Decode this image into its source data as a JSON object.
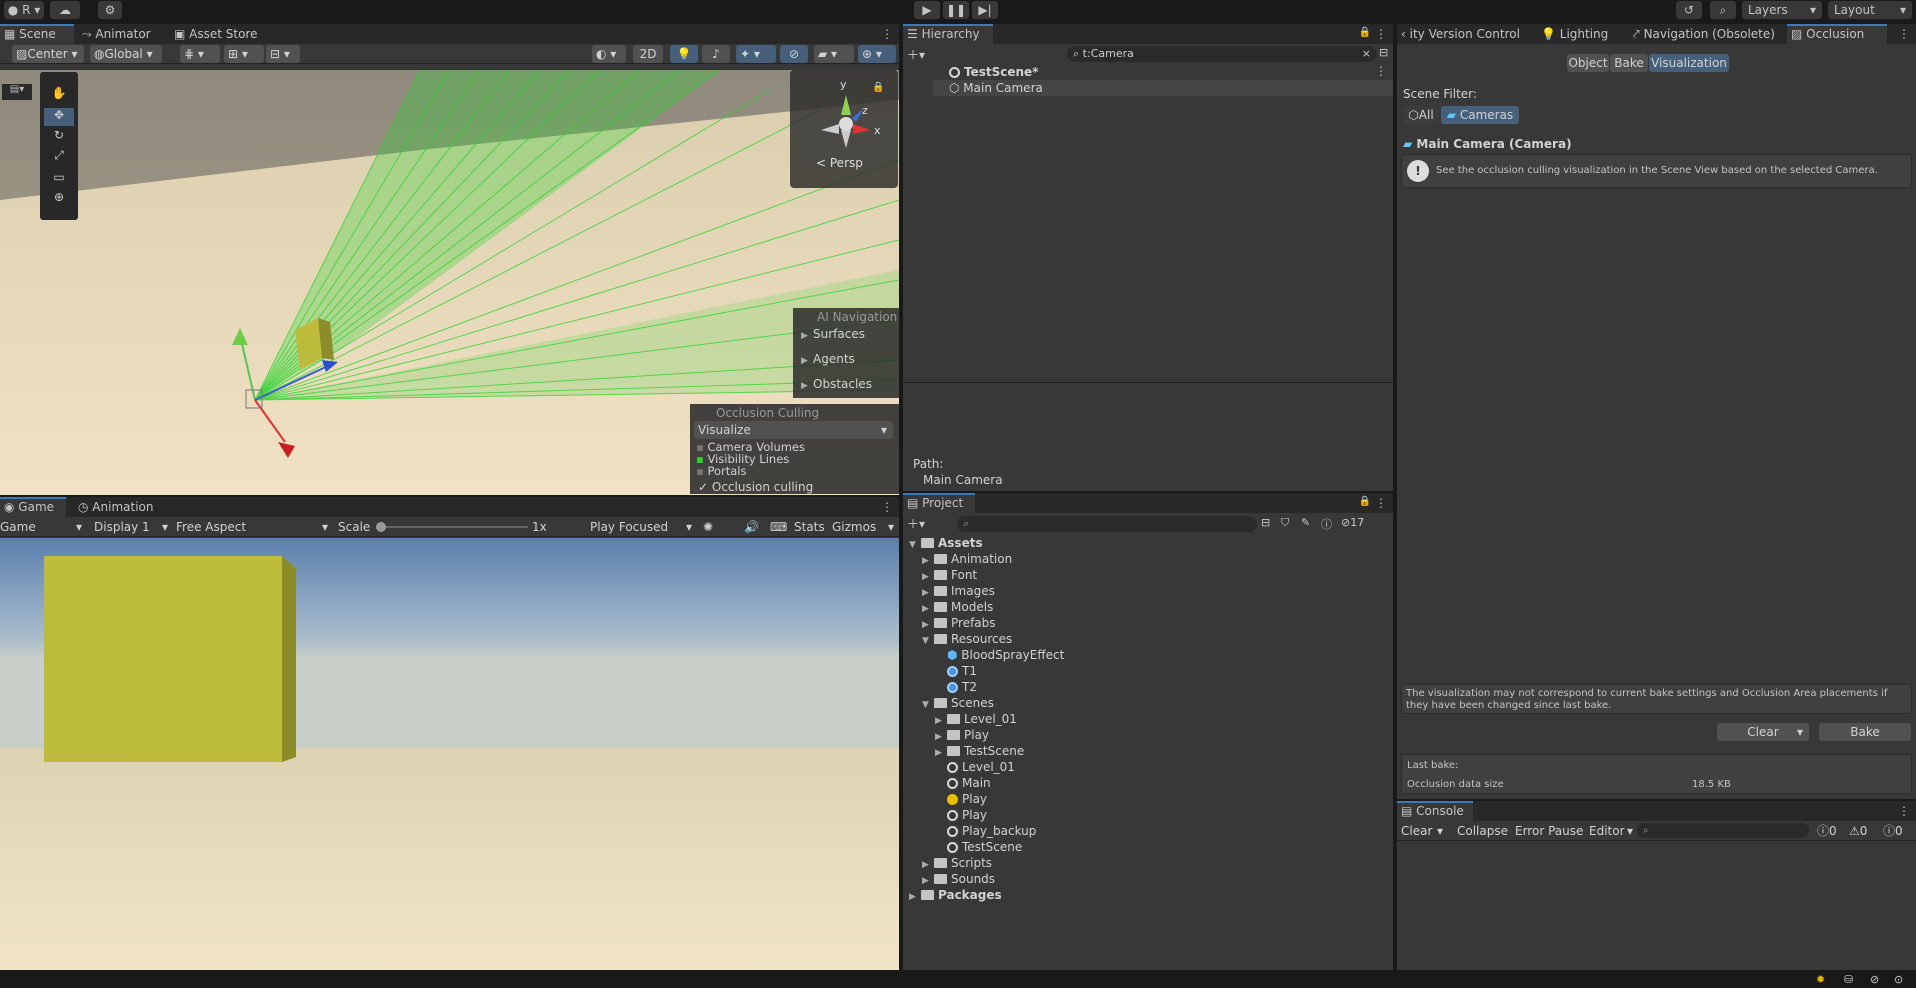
{
  "toolbar": {
    "account": "R",
    "layers": "Layers",
    "layout": "Layout"
  },
  "scene_tabs": [
    "Scene",
    "Animator",
    "Asset Store"
  ],
  "scene_toolbar": {
    "pivot": "Center",
    "space": "Global",
    "mode2d": "2D"
  },
  "gizmo": {
    "y": "y",
    "z": "z",
    "x": "x",
    "persp": "Persp"
  },
  "ai_nav": {
    "title": "AI Navigation",
    "items": [
      "Surfaces",
      "Agents",
      "Obstacles"
    ]
  },
  "occlusion_overlay": {
    "title": "Occlusion Culling",
    "mode": "Visualize",
    "items": [
      "Camera Volumes",
      "Visibility Lines",
      "Portals"
    ],
    "toggle": "Occlusion culling"
  },
  "game_tabs": [
    "Game",
    "Animation"
  ],
  "game_toolbar": {
    "game": "Game",
    "display": "Display 1",
    "aspect": "Free Aspect",
    "scale_label": "Scale",
    "scale_value": "1x",
    "play_mode": "Play Focused",
    "stats": "Stats",
    "gizmos": "Gizmos"
  },
  "hierarchy": {
    "tab": "Hierarchy",
    "search": "t:Camera",
    "scene": "TestScene*",
    "object": "Main Camera",
    "path_label": "Path:",
    "path_value": "Main Camera"
  },
  "project": {
    "tab": "Project",
    "hidden_count": "17",
    "tree": [
      {
        "label": "Assets",
        "indent": 0,
        "type": "folder",
        "arrow": "open",
        "bold": true
      },
      {
        "label": "Animation",
        "indent": 1,
        "type": "folder",
        "arrow": "closed"
      },
      {
        "label": "Font",
        "indent": 1,
        "type": "folder",
        "arrow": "closed"
      },
      {
        "label": "Images",
        "indent": 1,
        "type": "folder",
        "arrow": "closed"
      },
      {
        "label": "Models",
        "indent": 1,
        "type": "folder",
        "arrow": "closed"
      },
      {
        "label": "Prefabs",
        "indent": 1,
        "type": "folder",
        "arrow": "closed"
      },
      {
        "label": "Resources",
        "indent": 1,
        "type": "folder",
        "arrow": "open"
      },
      {
        "label": "BloodSprayEffect",
        "indent": 2,
        "type": "prefab",
        "arrow": ""
      },
      {
        "label": "T1",
        "indent": 2,
        "type": "material",
        "arrow": ""
      },
      {
        "label": "T2",
        "indent": 2,
        "type": "material",
        "arrow": ""
      },
      {
        "label": "Scenes",
        "indent": 1,
        "type": "folder",
        "arrow": "open"
      },
      {
        "label": "Level_01",
        "indent": 2,
        "type": "folder",
        "arrow": "closed"
      },
      {
        "label": "Play",
        "indent": 2,
        "type": "folder",
        "arrow": "closed"
      },
      {
        "label": "TestScene",
        "indent": 2,
        "type": "folder",
        "arrow": "closed"
      },
      {
        "label": "Level_01",
        "indent": 2,
        "type": "scene",
        "arrow": ""
      },
      {
        "label": "Main",
        "indent": 2,
        "type": "scene",
        "arrow": ""
      },
      {
        "label": "Play",
        "indent": 2,
        "type": "lighting",
        "arrow": ""
      },
      {
        "label": "Play",
        "indent": 2,
        "type": "scene",
        "arrow": ""
      },
      {
        "label": "Play_backup",
        "indent": 2,
        "type": "scene",
        "arrow": ""
      },
      {
        "label": "TestScene",
        "indent": 2,
        "type": "scene",
        "arrow": ""
      },
      {
        "label": "Scripts",
        "indent": 1,
        "type": "folder",
        "arrow": "closed"
      },
      {
        "label": "Sounds",
        "indent": 1,
        "type": "folder",
        "arrow": "closed"
      },
      {
        "label": "Packages",
        "indent": 0,
        "type": "folder",
        "arrow": "closed",
        "bold": true
      }
    ]
  },
  "right_tabs": [
    "ity Version Control",
    "Lighting",
    "Navigation (Obsolete)",
    "Occlusion"
  ],
  "occlusion": {
    "modes": [
      "Object",
      "Bake",
      "Visualization"
    ],
    "filter_label": "Scene Filter:",
    "filter_all": "All",
    "filter_cameras": "Cameras",
    "camera_title": "Main Camera (Camera)",
    "info": "See the occlusion culling visualization in the Scene View based on the selected Camera.",
    "warning": "The visualization may not correspond to current bake settings and Occlusion Area placements if they have been changed since last bake.",
    "clear": "Clear",
    "bake": "Bake",
    "last_bake": "Last bake:",
    "data_size_label": "Occlusion data size",
    "data_size_value": "18.5 KB"
  },
  "console": {
    "tab": "Console",
    "clear": "Clear",
    "collapse": "Collapse",
    "error_pause": "Error Pause",
    "editor": "Editor",
    "logs": "0",
    "warnings": "0",
    "errors": "0"
  },
  "colors": {
    "accent": "#3a79bb",
    "selected": "#2c5d87",
    "green": "#2bd42b",
    "cube": "#bcbb3b"
  }
}
